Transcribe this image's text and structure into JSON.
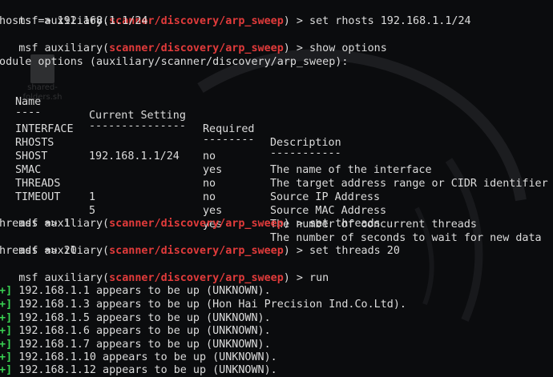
{
  "colors": {
    "background": "#0b0c0e",
    "text": "#dcdcdc",
    "module_path": "#e23b3b",
    "status_plus": "#39d353"
  },
  "desktop_icon": {
    "label": "shared-folders.sh"
  },
  "prompt": {
    "prefix": "msf auxiliary(",
    "module": "scanner/discovery/arp_sweep",
    "suffix": ") > "
  },
  "lines": {
    "cmd1": "set rhosts 192.168.1.1/24",
    "out1": "rhosts => 192.168.1.1/24",
    "cmd2": "show options",
    "module_options": "Module options (auxiliary/scanner/discovery/arp_sweep):",
    "cmd3": "set threads",
    "out3": "threads => 1",
    "cmd4": "set threads 20",
    "out4": "threads => 20",
    "cmd5": "run"
  },
  "options_table": {
    "headers": [
      "Name",
      "Current Setting",
      "Required",
      "Description"
    ],
    "separators": [
      "----",
      "---------------",
      "--------",
      "-----------"
    ],
    "rows": [
      [
        "INTERFACE",
        "",
        "no",
        "The name of the interface"
      ],
      [
        "RHOSTS",
        "192.168.1.1/24",
        "yes",
        "The target address range or CIDR identifier"
      ],
      [
        "SHOST",
        "",
        "no",
        "Source IP Address"
      ],
      [
        "SMAC",
        "",
        "no",
        "Source MAC Address"
      ],
      [
        "THREADS",
        "1",
        "yes",
        "The number of concurrent threads"
      ],
      [
        "TIMEOUT",
        "5",
        "yes",
        "The number of seconds to wait for new data"
      ]
    ]
  },
  "results": {
    "marker": "[+]",
    "items": [
      "192.168.1.1 appears to be up (UNKNOWN).",
      "192.168.1.3 appears to be up (Hon Hai Precision Ind.Co.Ltd).",
      "192.168.1.5 appears to be up (UNKNOWN).",
      "192.168.1.6 appears to be up (UNKNOWN).",
      "192.168.1.7 appears to be up (UNKNOWN).",
      "192.168.1.10 appears to be up (UNKNOWN).",
      "192.168.1.12 appears to be up (UNKNOWN)."
    ]
  }
}
